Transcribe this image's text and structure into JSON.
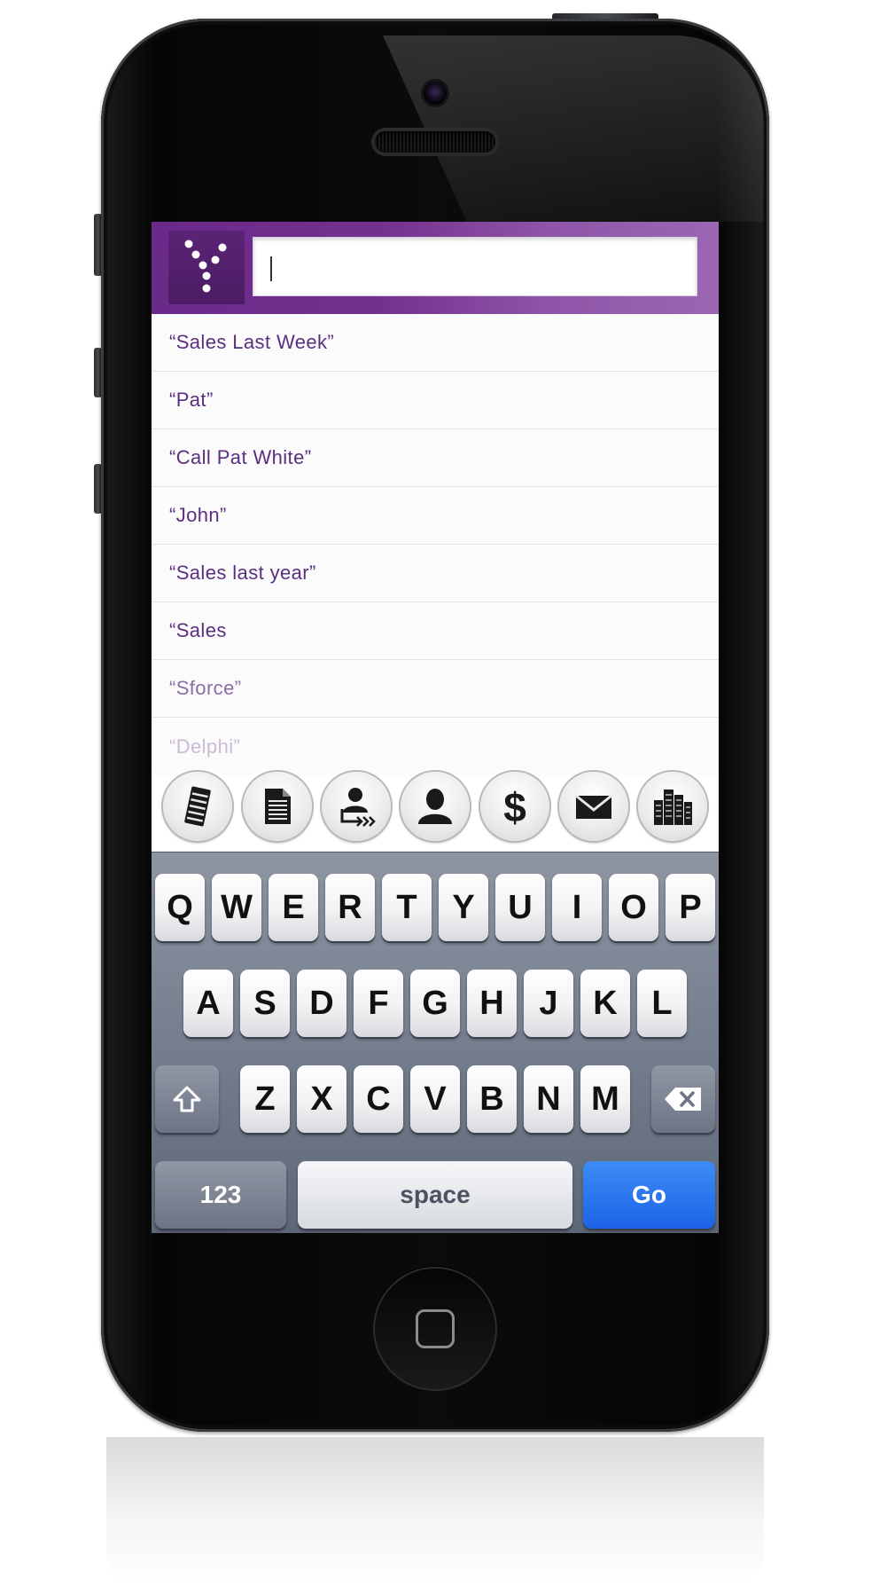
{
  "app": {
    "brand_color": "#74308e",
    "logo_icon": "y-dots-logo-icon"
  },
  "search": {
    "value": "",
    "placeholder": ""
  },
  "suggestions": [
    {
      "label": "“Sales Last Week”"
    },
    {
      "label": "“Pat”"
    },
    {
      "label": "“Call Pat White”"
    },
    {
      "label": "“John”"
    },
    {
      "label": "“Sales last year”"
    },
    {
      "label": "“Sales"
    },
    {
      "label": "“Sforce”"
    },
    {
      "label": "“Delphi”"
    }
  ],
  "categories": [
    {
      "icon": "list-notes-icon"
    },
    {
      "icon": "document-icon"
    },
    {
      "icon": "user-transfer-icon"
    },
    {
      "icon": "person-icon"
    },
    {
      "icon": "dollar-icon"
    },
    {
      "icon": "mail-icon"
    },
    {
      "icon": "buildings-icon"
    }
  ],
  "keyboard": {
    "row1": [
      "Q",
      "W",
      "E",
      "R",
      "T",
      "Y",
      "U",
      "I",
      "O",
      "P"
    ],
    "row2": [
      "A",
      "S",
      "D",
      "F",
      "G",
      "H",
      "J",
      "K",
      "L"
    ],
    "row3": [
      "Z",
      "X",
      "C",
      "V",
      "B",
      "N",
      "M"
    ],
    "shift_icon": "shift-arrow-icon",
    "delete_icon": "backspace-icon",
    "numbers_label": "123",
    "space_label": "space",
    "go_label": "Go",
    "go_color": "#1c63e6"
  }
}
